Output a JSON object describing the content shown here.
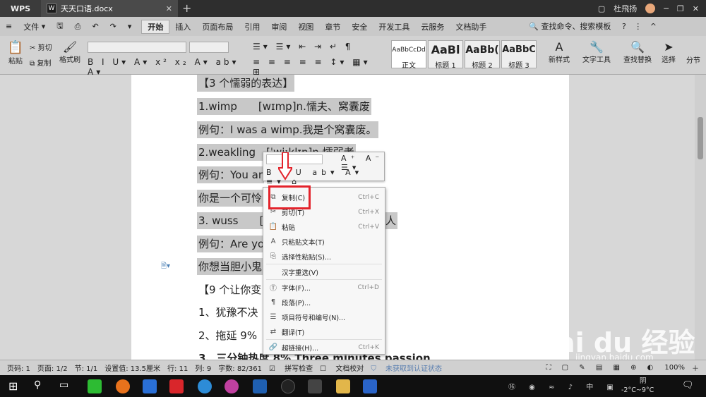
{
  "titlebar": {
    "app": "WPS",
    "doc_tab": "天天口语.docx",
    "user": "杜飛扬"
  },
  "menubar": {
    "file": "文件",
    "items": [
      "开始",
      "插入",
      "页面布局",
      "引用",
      "审阅",
      "视图",
      "章节",
      "安全",
      "开发工具",
      "云服务",
      "文档助手"
    ],
    "search": "查找命令、搜索模板"
  },
  "toolbar": {
    "cut": "剪切",
    "paste": "粘贴",
    "copy": "复制",
    "format_painter": "格式刷",
    "styles": [
      {
        "sample": "AaBbCcDd",
        "name": "正文"
      },
      {
        "sample": "AaBl",
        "name": "标题 1"
      },
      {
        "sample": "AaBb(",
        "name": "标题 2"
      },
      {
        "sample": "AaBbC",
        "name": "标题 3"
      }
    ],
    "new_style": "新样式",
    "text_tools": "文字工具",
    "find_replace": "查找替换",
    "select": "选择",
    "split": "分节"
  },
  "document": {
    "lines": [
      "【3 个懦弱的表达】",
      "1.wimp　　[wɪmp]n.懦夫、窝囊废",
      "例句：I was a wimp.我是个窝囊废。",
      "2.weakling　[ˈwiːklɪŋ]n.懦弱者",
      "例句：You ar",
      "你是一个可怜",
      "3. wuss　　[w",
      "例句：Are yo",
      "你想当胆小鬼",
      "【9 个让你变",
      "1、犹豫不决",
      "2、拖延  9%",
      "3、三分钟热度  8% Three minutes passion"
    ],
    "tail_6": "人"
  },
  "context_menu": {
    "items": [
      {
        "label": "复制(C)",
        "shortcut": "Ctrl+C",
        "icon": "copy-icon"
      },
      {
        "label": "剪切(T)",
        "shortcut": "Ctrl+X",
        "icon": "scissors-icon"
      },
      {
        "label": "粘贴",
        "shortcut": "Ctrl+V",
        "icon": "paste-icon"
      },
      {
        "label": "只粘贴文本(T)",
        "shortcut": "",
        "icon": "paste-text-icon"
      },
      {
        "label": "选择性粘贴(S)...",
        "shortcut": "",
        "icon": "paste-special-icon"
      },
      {
        "label": "汉字重选(V)",
        "shortcut": "",
        "icon": ""
      },
      {
        "label": "字体(F)...",
        "shortcut": "Ctrl+D",
        "icon": "font-icon"
      },
      {
        "label": "段落(P)...",
        "shortcut": "",
        "icon": "paragraph-icon"
      },
      {
        "label": "项目符号和编号(N)...",
        "shortcut": "",
        "icon": "list-icon"
      },
      {
        "label": "翻译(T)",
        "shortcut": "",
        "icon": "translate-icon"
      },
      {
        "label": "超链接(H)...",
        "shortcut": "Ctrl+K",
        "icon": "link-icon"
      }
    ]
  },
  "statusbar": {
    "page_num": "页码: 1",
    "pages": "页面: 1/2",
    "section": "节: 1/1",
    "setting": "设置值: 13.5厘米",
    "row": "行: 11",
    "col": "列: 9",
    "words": "字数: 82/361",
    "spell": "拼写检查",
    "proof": "文档校对",
    "auth": "未获取到认证状态",
    "zoom": "100%"
  },
  "taskbar": {
    "weather": "阴",
    "temp": "-2°C~9°C",
    "ime": "中"
  },
  "watermark": {
    "brand": "Bai du 经验",
    "url": "jingyan.baidu.com"
  }
}
